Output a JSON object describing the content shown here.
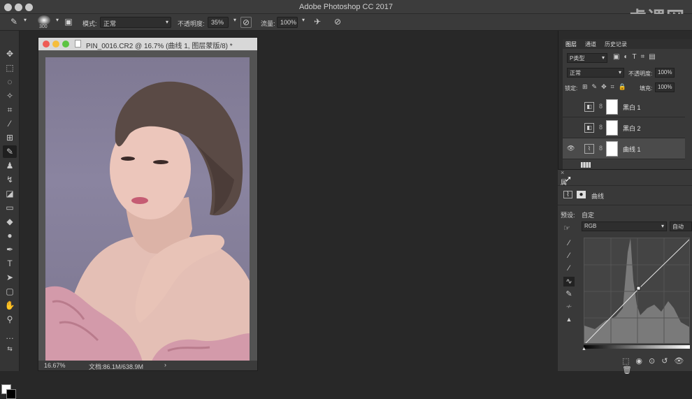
{
  "titlebar": {
    "title": "Adobe Photoshop CC 2017"
  },
  "watermark": {
    "text": "虎课网"
  },
  "options": {
    "brush_size": "300",
    "mode_label": "模式:",
    "mode_value": "正常",
    "opacity_label": "不透明度:",
    "opacity_value": "35%",
    "flow_label": "流量:",
    "flow_value": "100%"
  },
  "document": {
    "tab_title": "PIN_0016.CR2 @ 16.7% (曲线 1, 图层蒙版/8) *",
    "zoom": "16.67%",
    "doc_info": "文档:86.1M/638.9M"
  },
  "layers_panel": {
    "tabs": [
      "图层",
      "通道",
      "历史记录"
    ],
    "filter_label": "P类型",
    "blend_mode": "正常",
    "opacity_label": "不透明度:",
    "opacity_value": "100%",
    "lock_label": "锁定:",
    "fill_label": "填充:",
    "fill_value": "100%",
    "layers": [
      {
        "name": "黑白 1",
        "visible": false,
        "selected": false
      },
      {
        "name": "黑白 2",
        "visible": false,
        "selected": false
      },
      {
        "name": "曲线 1",
        "visible": true,
        "selected": true
      }
    ]
  },
  "properties_panel": {
    "tab": "属",
    "adj_name": "曲线",
    "preset_label": "预设:",
    "preset_value": "自定",
    "channel_value": "RGB",
    "auto_label": "自动"
  },
  "colors": {
    "accent": "#4b4b4b",
    "photo_bg": "#817b95",
    "sweater": "#d39aaa"
  }
}
